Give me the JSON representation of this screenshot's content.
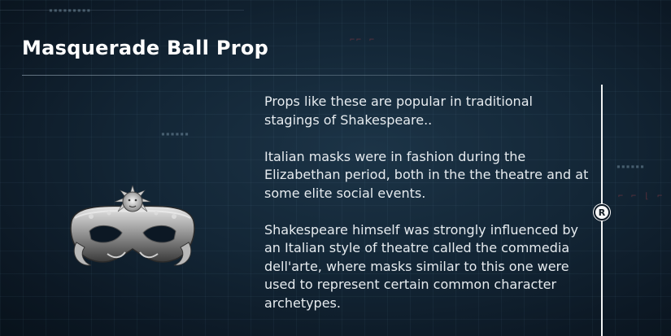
{
  "item": {
    "title": "Masquerade Ball Prop",
    "image": "venetian-mask-icon"
  },
  "description": {
    "paragraphs": [
      "Props like these are popular in traditional stagings of Shakespeare..",
      "Italian masks were in fashion during the Elizabethan period, both in the the theatre and at some elite social events.",
      "Shakespeare himself was strongly influenced by an Italian style of theatre called the commedia dell'arte, where masks similar to this one were used to represent certain common character archetypes."
    ]
  },
  "controls": {
    "scroll_button_label": "R"
  },
  "colors": {
    "background": "#132636",
    "text": "#e6ebef",
    "title": "#ffffff",
    "accent": "#f2f4f5"
  }
}
